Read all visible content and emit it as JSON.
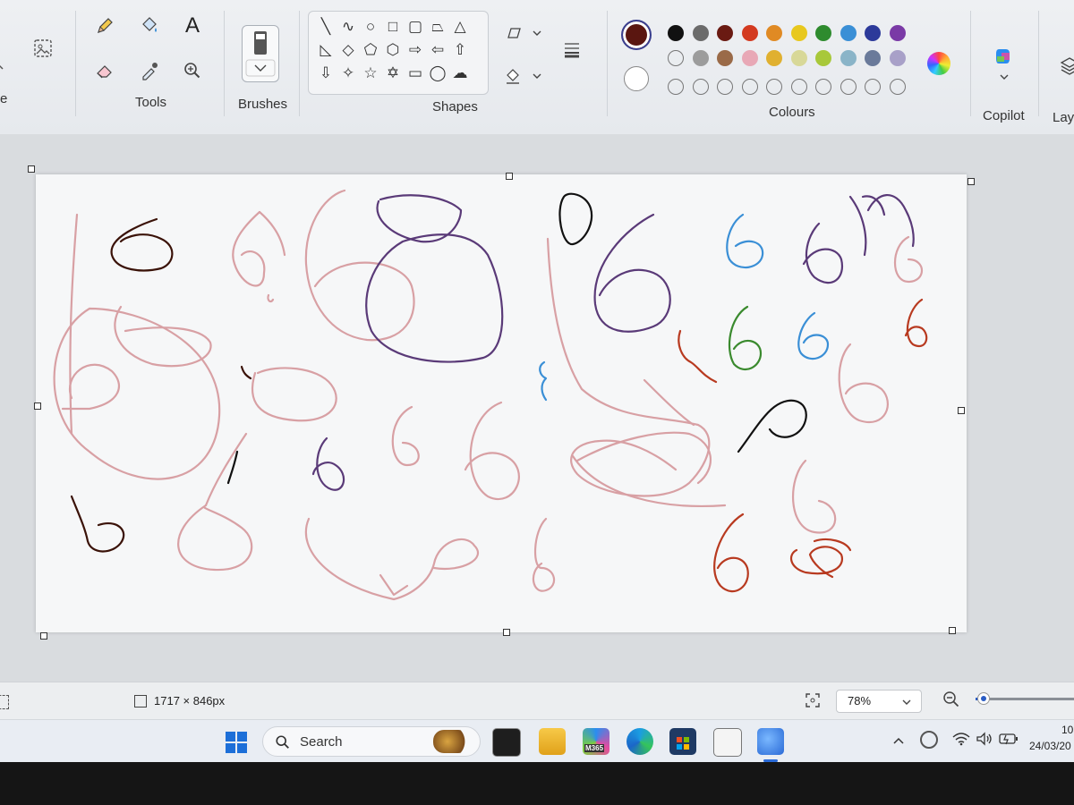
{
  "ribbon": {
    "partial_left_label": "e",
    "groups": {
      "tools_label": "Tools",
      "brushes_label": "Brushes",
      "shapes_label": "Shapes",
      "colours_label": "Colours",
      "copilot_label": "Copilot",
      "layers_label": "Laye"
    },
    "text_tool_glyph": "A",
    "active_colour": "#5a1610",
    "palette_row1": [
      "#111111",
      "#6b6b6b",
      "#6a1a12",
      "#d33a20",
      "#e08a24",
      "#e8c81e",
      "#2e8b2e",
      "#3a8fd6",
      "#2c3a9a",
      "#7a3aa6"
    ],
    "palette_row2": [
      "empty",
      "#9c9c9c",
      "#9a6a48",
      "#e8a8b6",
      "#e0b030",
      "#d8d898",
      "#a8c83a",
      "#8ab4c8",
      "#6a7a9a",
      "#a8a0c8"
    ],
    "palette_row3": [
      "empty",
      "empty",
      "empty",
      "empty",
      "empty",
      "empty",
      "empty",
      "empty",
      "empty",
      "empty"
    ]
  },
  "status": {
    "dimensions": "1717 × 846px",
    "zoom": "78%",
    "zoom_slider_level": 0.08
  },
  "taskbar": {
    "search_placeholder": "Search",
    "pinned_icons": [
      "windows-start-icon",
      "terminal-icon",
      "file-explorer-icon",
      "m365-icon",
      "edge-icon",
      "microsoft-store-icon",
      "app-icon",
      "paint-icon"
    ],
    "m365_label": "M365",
    "clock_time": "10",
    "clock_date": "24/03/20"
  },
  "canvas_strokes": {
    "pink": "#d8a0a4",
    "purple": "#5a3a78",
    "dark_brown": "#3a1208",
    "blue": "#3a8fd6",
    "green": "#3a8a2e",
    "red": "#b83a20",
    "black": "#111111"
  }
}
